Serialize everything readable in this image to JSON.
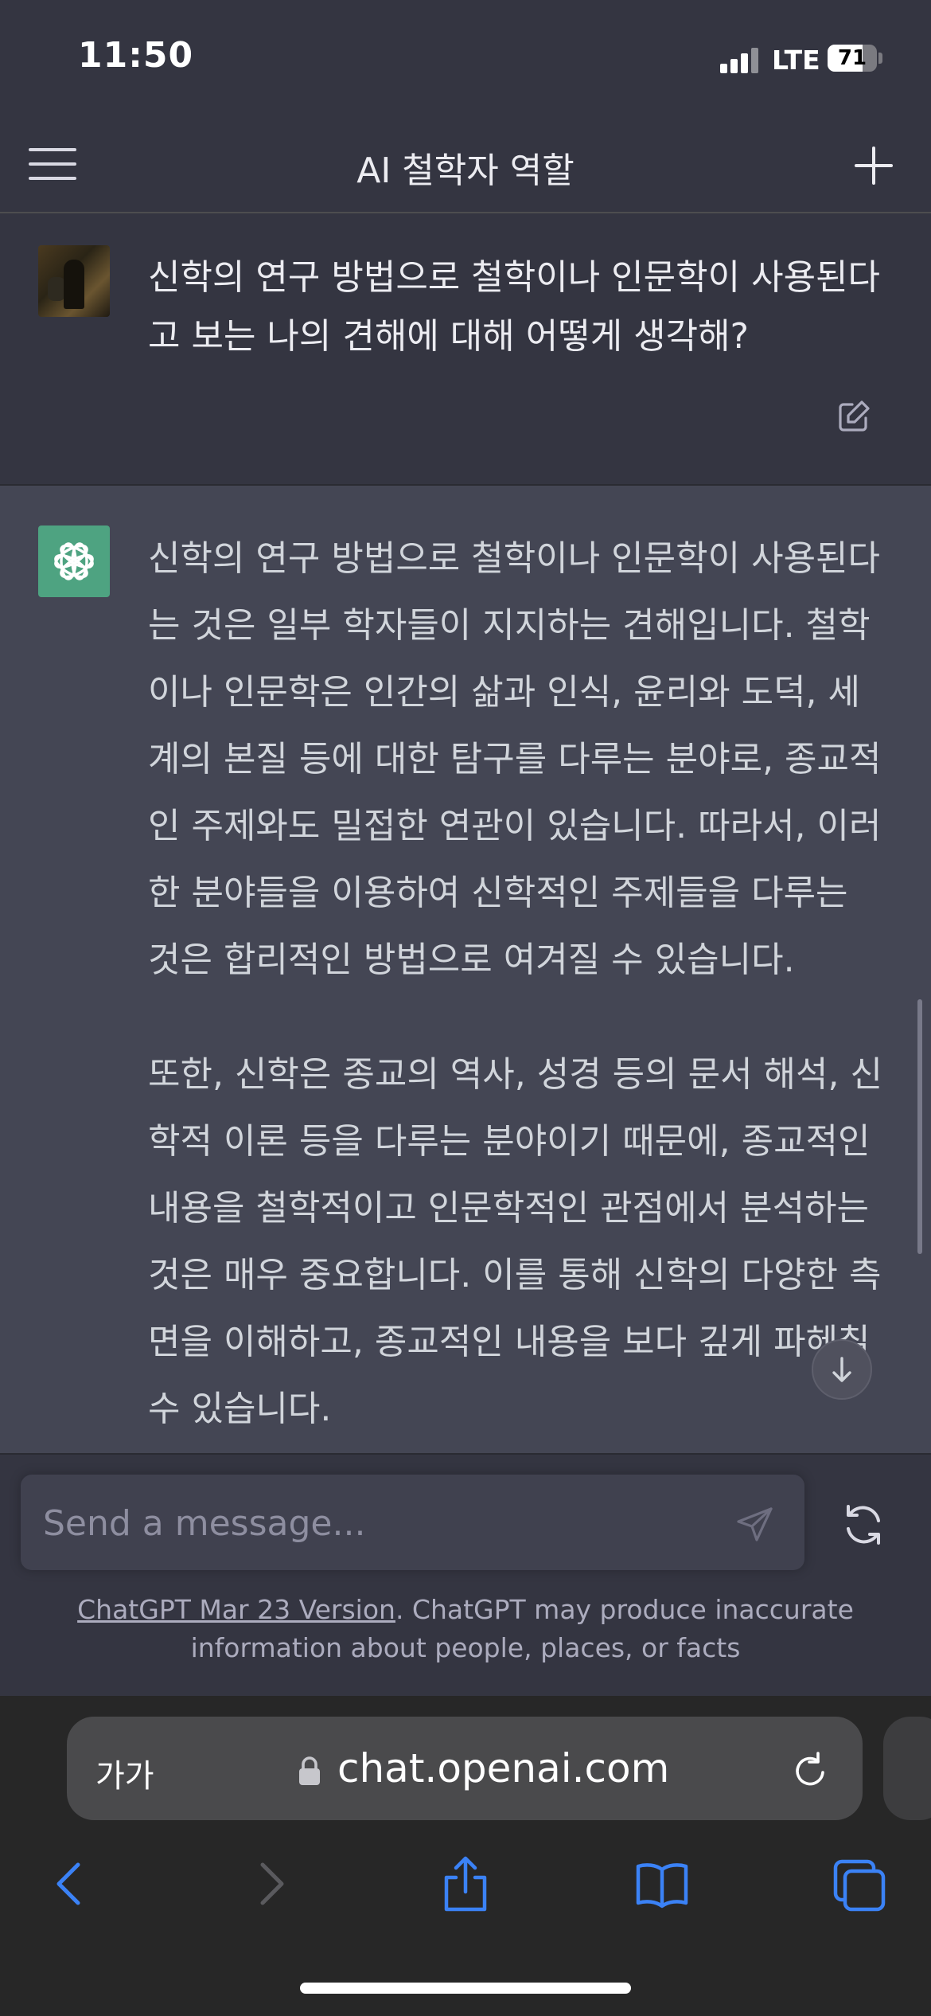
{
  "status_bar": {
    "time": "11:50",
    "network": "LTE",
    "battery": "71",
    "battery_level": 0.71
  },
  "header": {
    "title": "AI 철학자 역할",
    "menu_icon": "hamburger-menu-icon",
    "new_chat_icon": "plus-icon"
  },
  "user_message": {
    "text": "신학의 연구 방법으로 철학이나 인문학이 사용된다고 보는 나의 견해에 대해 어떻게 생각해?",
    "edit_icon": "edit-icon"
  },
  "assistant_message": {
    "paragraphs": [
      "신학의 연구 방법으로 철학이나 인문학이 사용된다는 것은 일부 학자들이 지지하는 견해입니다. 철학이나 인문학은 인간의 삶과 인식, 윤리와 도덕, 세계의 본질 등에 대한 탐구를 다루는 분야로, 종교적인 주제와도 밀접한 연관이 있습니다. 따라서, 이러한 분야들을 이용하여 신학적인 주제들을 다루는 것은 합리적인 방법으로 여겨질 수 있습니다.",
      "또한, 신학은 종교의 역사, 성경 등의 문서 해석, 신학적 이론 등을 다루는 분야이기 때문에, 종교적인 내용을 철학적이고 인문학적인 관점에서 분석하는 것은 매우 중요합니다. 이를 통해 신학의 다양한 측면을 이해하고, 종교적인 내용을 보다 깊게 파헤칠 수 있습니다."
    ]
  },
  "composer": {
    "placeholder": "Send a message...",
    "footer_link": "ChatGPT Mar 23 Version",
    "footer_text": ". ChatGPT may produce inaccurate information about people, places, or facts"
  },
  "browser": {
    "text_size_label": "가가",
    "url": "chat.openai.com"
  },
  "colors": {
    "background": "#343541",
    "assistant_background": "#444654",
    "gpt_avatar": "#4ea381",
    "safari_accent": "#3b82f6"
  }
}
